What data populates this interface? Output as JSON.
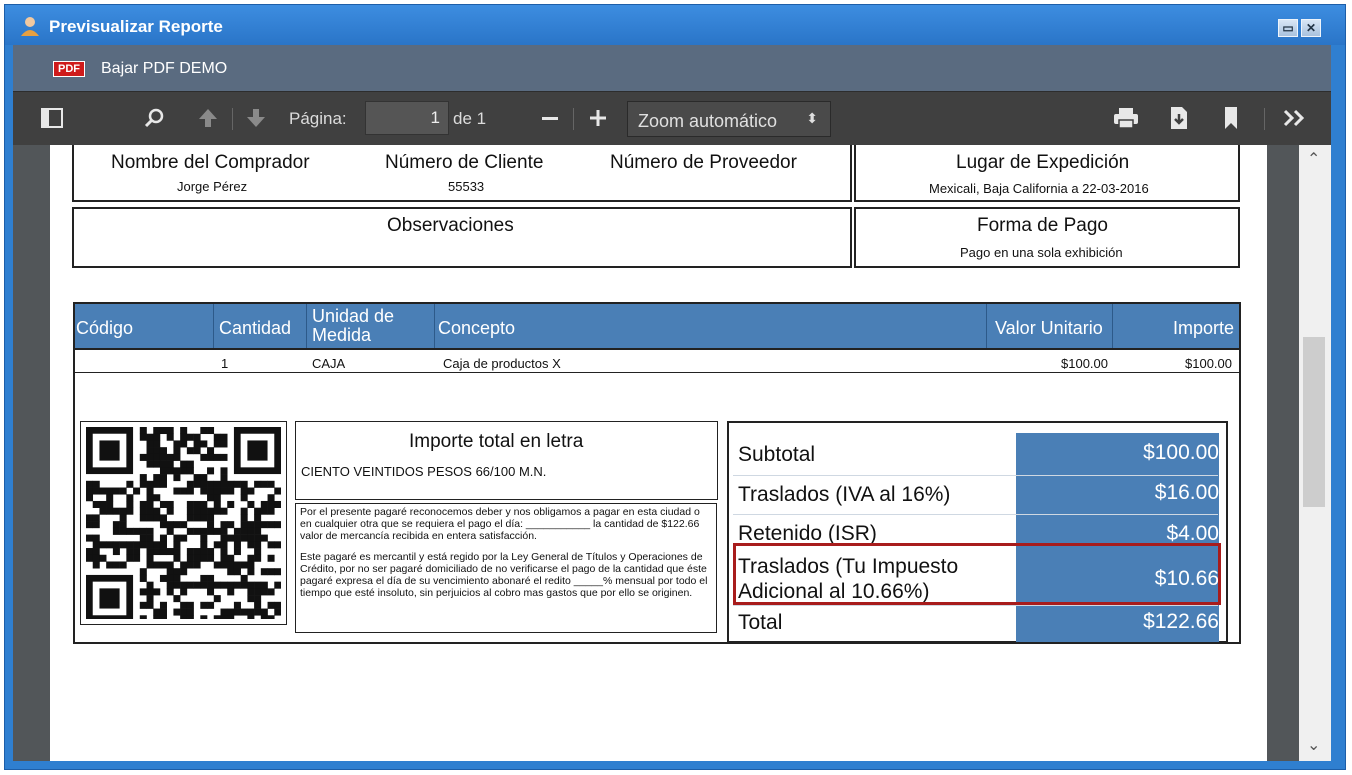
{
  "window": {
    "title": "Previsualizar Reporte"
  },
  "pdfbar": {
    "badge": "PDF",
    "label": "Bajar PDF DEMO"
  },
  "toolbar": {
    "page_label": "Página:",
    "page_value": "1",
    "page_of": "de 1",
    "zoom": "Zoom automático"
  },
  "header_boxes": {
    "comprador_label": "Nombre del Comprador",
    "comprador_value": "Jorge Pérez",
    "cliente_label": "Número de Cliente",
    "cliente_value": "55533",
    "proveedor_label": "Número de Proveedor",
    "lugar_label": "Lugar de Expedición",
    "lugar_value": "Mexicali, Baja California a 22-03-2016",
    "observaciones_label": "Observaciones",
    "forma_pago_label": "Forma de Pago",
    "forma_pago_value": "Pago en una sola exhibición"
  },
  "items_table": {
    "columns": [
      "Código",
      "Cantidad",
      "Unidad de\nMedida",
      "Concepto",
      "Valor Unitario",
      "Importe"
    ],
    "rows": [
      {
        "codigo": "",
        "cantidad": "1",
        "unidad": "CAJA",
        "concepto": "Caja de productos X",
        "valor_unitario": "$100.00",
        "importe": "$100.00"
      }
    ]
  },
  "importe_letra": {
    "title": "Importe total en letra",
    "value": "CIENTO VEINTIDOS PESOS 66/100 M.N."
  },
  "pagare": {
    "p1": "Por el presente pagaré reconocemos deber y nos obligamos a pagar en esta ciudad o en cualquier otra que se requiera el pago el día: ___________ la cantidad de $122.66 valor de mercancía recibida en entera satisfacción.",
    "p2": "Este pagaré es mercantil y está regido por la Ley General de Títulos y Operaciones de Crédito, por no ser pagaré domiciliado de no verificarse el pago de la cantidad que éste pagaré expresa el día de su vencimiento abonaré el redito _____% mensual por todo el tiempo que esté insoluto, sin perjuicios al cobro mas gastos que por ello se originen."
  },
  "totals": {
    "subtotal_label": "Subtotal",
    "subtotal_value": "$100.00",
    "iva_label": "Traslados (IVA al 16%)",
    "iva_value": "$16.00",
    "isr_label": "Retenido (ISR)",
    "isr_value": "$4.00",
    "adicional_label_1": "Traslados (Tu Impuesto",
    "adicional_label_2": "Adicional al 10.66%)",
    "adicional_value": "$10.66",
    "total_label": "Total",
    "total_value": "$122.66"
  },
  "colors": {
    "accent": "#4a7fb6",
    "highlight": "#a81c1c",
    "titlebar": "#2f7fd0",
    "toolbar": "#404040"
  }
}
